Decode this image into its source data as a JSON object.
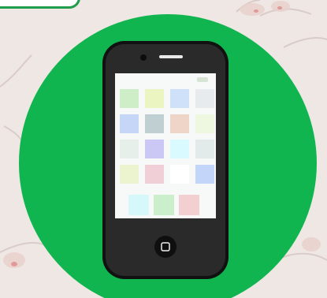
{
  "scene": {
    "background_color": "#efe7e4",
    "circle_color": "#10b54f",
    "tab_border_color": "#1f9d4c"
  },
  "phone": {
    "body_color": "#1f1f1f",
    "bezel_color": "#2a2a2a",
    "screen_color": "#f7f8f8",
    "home_button_icon": "home-button-icon",
    "app_grid_rows": [
      [
        "#cdeec7",
        "#eaf5c2",
        "#cfe1f8",
        "#e7ebee"
      ],
      [
        "#c6d6f7",
        "#bfcfd2",
        "#efd5c7",
        "#eef7df"
      ],
      [
        "#e6efe9",
        "#ccc8f5",
        "#d9fafe",
        "#e2ebe9"
      ],
      [
        "#ecf3cf",
        "#f0cfd7",
        "#ffffff",
        "#c4d5fa"
      ]
    ],
    "dock_apps": [
      "#d7f8fb",
      "#cbefcb",
      "#f3cfd2"
    ]
  }
}
